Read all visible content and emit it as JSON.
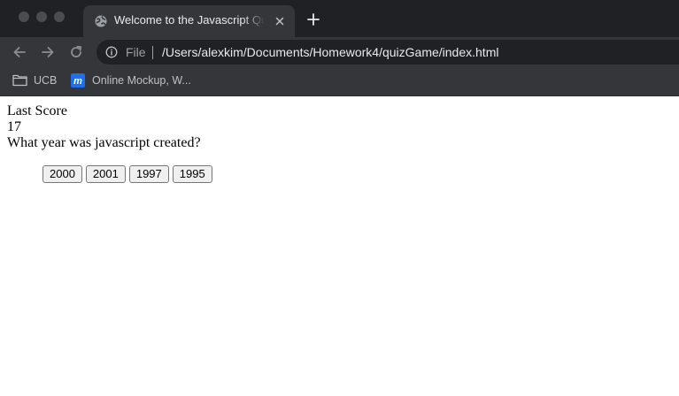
{
  "browser": {
    "tab": {
      "title": "Welcome to the Javascript Quiz"
    },
    "address_bar": {
      "scheme_label": "File",
      "url": "/Users/alexkim/Documents/Homework4/quizGame/index.html"
    },
    "bookmarks": [
      {
        "label": "UCB",
        "icon": "folder-icon"
      },
      {
        "label": "Online Mockup, W...",
        "icon": "moqups-icon"
      }
    ]
  },
  "page": {
    "last_score_label": "Last Score",
    "last_score_value": "17",
    "question": "What year was javascript created?",
    "choices": [
      "2000",
      "2001",
      "1997",
      "1995"
    ]
  },
  "colors": {
    "tab_strip": "#202124",
    "toolbar": "#35363a",
    "omnibox": "#202124",
    "page_background": "#ffffff"
  }
}
